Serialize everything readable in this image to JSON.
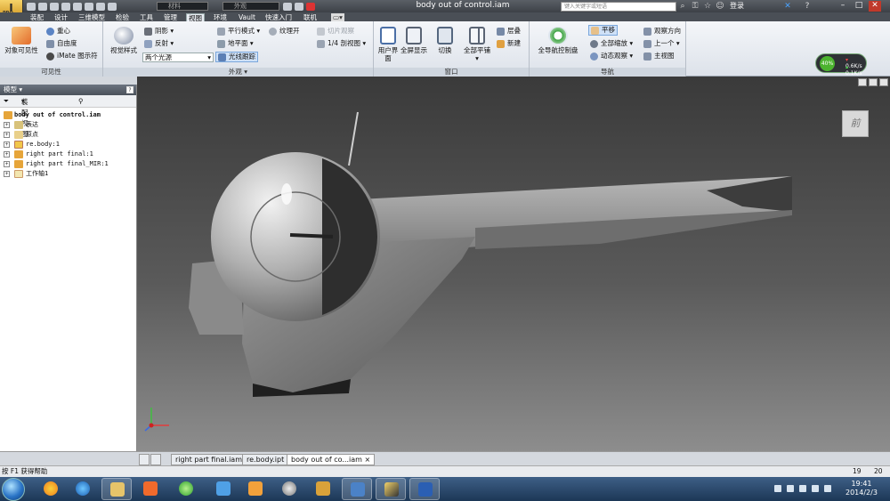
{
  "window": {
    "title": "body out of control.iam",
    "app_badge": "PRO",
    "material_field": "材料",
    "appearance_field": "外观",
    "search_placeholder": "键入关键字或短语",
    "login_label": "登录"
  },
  "menu_tabs": [
    "装配",
    "设计",
    "三维模型",
    "检验",
    "工具",
    "管理",
    "视图",
    "环境",
    "Vault",
    "快速入门",
    "联机"
  ],
  "active_tab": "视图",
  "ribbon": {
    "visibility": {
      "label": "可见性",
      "object_visibility": "对象可见性",
      "center_of_gravity": "重心",
      "dof": "自由度",
      "imate_glyph": "iMate 图示符"
    },
    "appearance": {
      "label": "外观",
      "visual_style": "视觉样式",
      "shadows": "阴影",
      "reflection": "反射",
      "lighting": "两个光源",
      "perspective": "平行模式",
      "ground_plane": "地平面",
      "texture": "纹理开",
      "ray_tracing": "光线跟踪",
      "slice": "切片观察",
      "quarter_section": "1/4 剖视图"
    },
    "windows": {
      "label": "窗口",
      "user_interface": "用户界面",
      "full_screen": "全屏显示",
      "switch": "切换",
      "tile_all": "全部平铺",
      "cascade": "层叠",
      "new": "新建"
    },
    "navigate": {
      "label": "导航",
      "steering_wheels": "全导航控制盘",
      "pan": "平移",
      "zoom_all": "全部缩放",
      "orbit": "动态观察",
      "look_at": "观察方向",
      "previous": "上一个",
      "home_view": "主视图"
    }
  },
  "network": {
    "percent": "40%",
    "down": "0.6K/s",
    "up": "0.1K/s"
  },
  "browser": {
    "title": "模型",
    "help": "?",
    "view_mode": "装配视图",
    "root": "body out of control.iam",
    "items": [
      "表达",
      "原点",
      "re.body:1",
      "right part final:1",
      "right part final_MIR:1",
      "工作轴1"
    ]
  },
  "viewcube_label": "前",
  "doc_tabs": [
    "right part final.iam",
    "re.body.ipt",
    "body out of co...iam"
  ],
  "active_doc": "body out of co...iam",
  "status": {
    "help_text": "按 F1 获得帮助",
    "count_a": "19",
    "count_b": "20"
  },
  "clock": {
    "time": "19:41",
    "date": "2014/2/3"
  }
}
